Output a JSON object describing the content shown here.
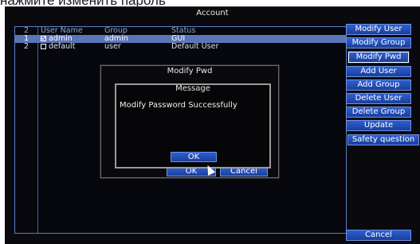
{
  "caption": "нажмите изменить пароль",
  "window": {
    "title": "Account"
  },
  "table": {
    "headers": {
      "num": "2",
      "name": "User Name",
      "group": "Group",
      "status": "Status"
    },
    "rows": [
      {
        "num": "1",
        "name": "admin",
        "group": "admin",
        "status": "GUI",
        "checked": true
      },
      {
        "num": "2",
        "name": "default",
        "group": "user",
        "status": "Default User",
        "checked": false
      }
    ]
  },
  "buttons": {
    "modify_user": "Modify User",
    "modify_group": "Modify Group",
    "modify_pwd": "Modify Pwd",
    "add_user": "Add User",
    "add_group": "Add Group",
    "delete_user": "Delete User",
    "delete_group": "Delete Group",
    "update": "Update",
    "safety_question": "Safety question",
    "cancel": "Cancel"
  },
  "modify_pwd_dialog": {
    "title": "Modify Pwd",
    "ok": "OK",
    "cancel": "Cancel"
  },
  "message_dialog": {
    "title": "Message",
    "text": "Modify Password Successfully",
    "ok": "OK"
  },
  "colors": {
    "button_blue": "#2d5fd0",
    "selection": "#5b76b8",
    "border": "#5a7fc8"
  }
}
